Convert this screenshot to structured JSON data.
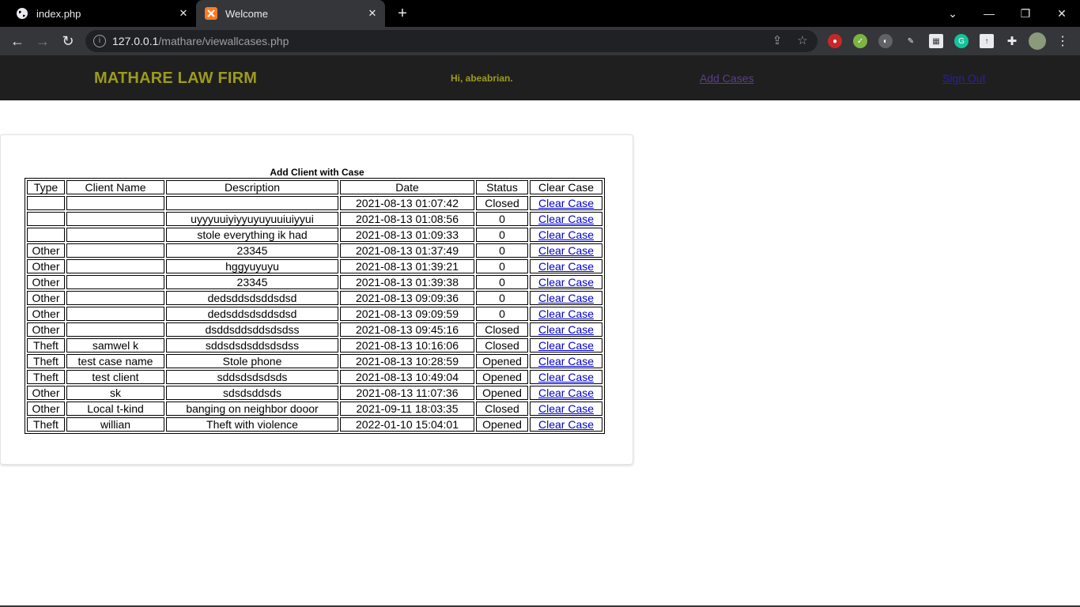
{
  "browser": {
    "tabs": [
      {
        "title": "index.php"
      },
      {
        "title": "Welcome"
      }
    ],
    "url_host": "127.0.0.1",
    "url_path": "/mathare/viewallcases.php"
  },
  "header": {
    "brand": "MATHARE LAW FIRM",
    "greeting": "Hi, abeabrian.",
    "add_cases": "Add Cases",
    "sign_out": "Sign Out"
  },
  "table": {
    "caption": "Add Client with Case",
    "columns": [
      "Type",
      "Client Name",
      "Description",
      "Date",
      "Status",
      "Clear Case"
    ],
    "rows": [
      {
        "type": "",
        "client": "",
        "description": "",
        "date": "2021-08-13 01:07:42",
        "status": "Closed",
        "action": "Clear Case"
      },
      {
        "type": "",
        "client": "",
        "description": "uyyyuuiyiyyuyuyuuiuiyyui",
        "date": "2021-08-13 01:08:56",
        "status": "0",
        "action": "Clear Case"
      },
      {
        "type": "",
        "client": "",
        "description": "stole everything ik had",
        "date": "2021-08-13 01:09:33",
        "status": "0",
        "action": "Clear Case"
      },
      {
        "type": "Other",
        "client": "",
        "description": "23345",
        "date": "2021-08-13 01:37:49",
        "status": "0",
        "action": "Clear Case"
      },
      {
        "type": "Other",
        "client": "",
        "description": "hggyuyuyu",
        "date": "2021-08-13 01:39:21",
        "status": "0",
        "action": "Clear Case"
      },
      {
        "type": "Other",
        "client": "",
        "description": "23345",
        "date": "2021-08-13 01:39:38",
        "status": "0",
        "action": "Clear Case"
      },
      {
        "type": "Other",
        "client": "",
        "description": "dedsddsdsddsdsd",
        "date": "2021-08-13 09:09:36",
        "status": "0",
        "action": "Clear Case"
      },
      {
        "type": "Other",
        "client": "",
        "description": "dedsddsdsddsdsd",
        "date": "2021-08-13 09:09:59",
        "status": "0",
        "action": "Clear Case"
      },
      {
        "type": "Other",
        "client": "",
        "description": "dsddsddsddsdsdss",
        "date": "2021-08-13 09:45:16",
        "status": "Closed",
        "action": "Clear Case"
      },
      {
        "type": "Theft",
        "client": "samwel k",
        "description": "sddsdsdsddsdsdss",
        "date": "2021-08-13 10:16:06",
        "status": "Closed",
        "action": "Clear Case"
      },
      {
        "type": "Theft",
        "client": "test case name",
        "description": "Stole phone",
        "date": "2021-08-13 10:28:59",
        "status": "Opened",
        "action": "Clear Case"
      },
      {
        "type": "Theft",
        "client": "test client",
        "description": "sddsdsdsdsds",
        "date": "2021-08-13 10:49:04",
        "status": "Opened",
        "action": "Clear Case"
      },
      {
        "type": "Other",
        "client": "sk",
        "description": "sdsdsddsds",
        "date": "2021-08-13 11:07:36",
        "status": "Opened",
        "action": "Clear Case"
      },
      {
        "type": "Other",
        "client": "Local t-kind",
        "description": "banging on neighbor dooor",
        "date": "2021-09-11 18:03:35",
        "status": "Closed",
        "action": "Clear Case"
      },
      {
        "type": "Theft",
        "client": "willian",
        "description": "Theft with violence",
        "date": "2022-01-10 15:04:01",
        "status": "Opened",
        "action": "Clear Case"
      }
    ]
  }
}
